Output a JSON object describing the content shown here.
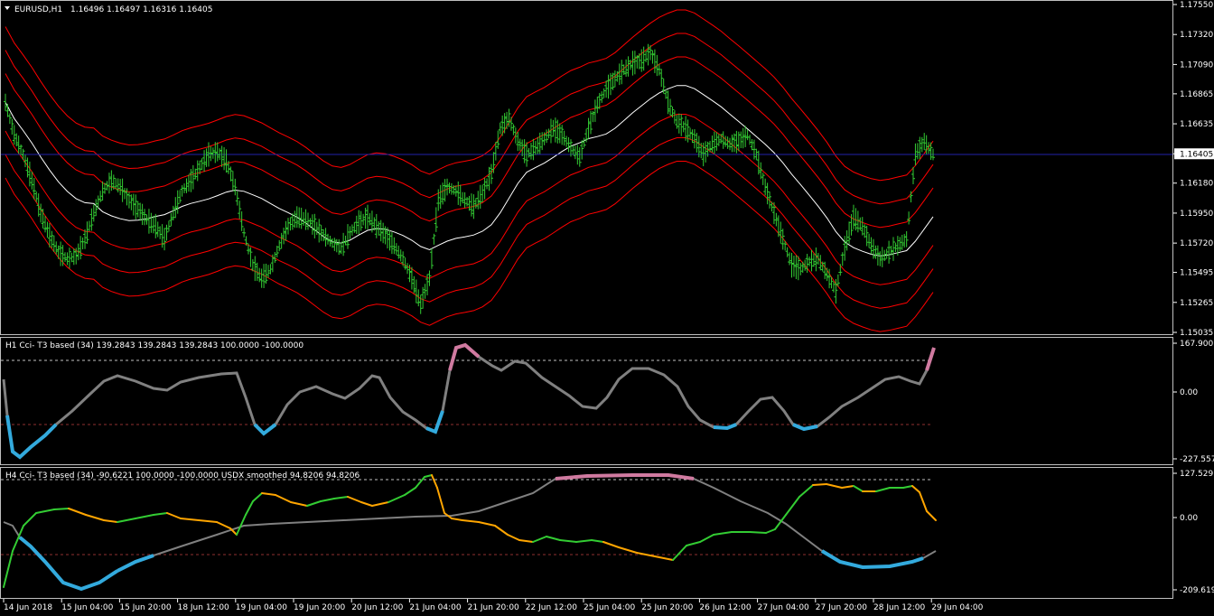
{
  "window": {
    "symbol_header": "EURUSD,H1",
    "ohlc": "1.16496 1.16497 1.16316 1.16405"
  },
  "panels": {
    "main": {
      "price_ticks": [
        "1.17550",
        "1.17320",
        "1.17090",
        "1.16865",
        "1.16635",
        "1.16405",
        "1.16180",
        "1.15950",
        "1.15720",
        "1.15495",
        "1.15265",
        "1.15035"
      ],
      "current_price": "1.16405"
    },
    "cci_h1": {
      "title": "H1 Cci- T3 based (34) 139.2843 139.2843 139.2843 100.0000 -100.0000",
      "ticks": [
        "167.9007",
        "0.00",
        "-227.5573"
      ]
    },
    "cci_h4": {
      "title": "H4 Cci- T3 based (34) -90.6221 100.0000 -100.0000  USDX smoothed  94.8206 94.8206",
      "ticks": [
        "127.5291",
        "0.00",
        "-209.6193"
      ]
    }
  },
  "time_axis": [
    "14 Jun 2018",
    "15 Jun 04:00",
    "15 Jun 20:00",
    "18 Jun 12:00",
    "19 Jun 04:00",
    "19 Jun 20:00",
    "20 Jun 12:00",
    "21 Jun 04:00",
    "21 Jun 20:00",
    "22 Jun 12:00",
    "25 Jun 04:00",
    "25 Jun 20:00",
    "26 Jun 12:00",
    "27 Jun 04:00",
    "27 Jun 20:00",
    "28 Jun 12:00",
    "29 Jun 04:00"
  ],
  "colors": {
    "background": "#000000",
    "candles": "#33cc33",
    "bands": "#ff0000",
    "midline": "#ffffff",
    "price_line": "#2222aa",
    "cci_neutral": "#808080",
    "cci_high": "#d07aa0",
    "cci_low": "#33aadd",
    "h4_up": "#33cc33",
    "h4_down": "#ffa500",
    "levels": "#c04040"
  },
  "chart_data": {
    "type": "line",
    "price_close": [
      1.168,
      1.1655,
      1.164,
      1.162,
      1.1595,
      1.1578,
      1.1565,
      1.156,
      1.1562,
      1.1575,
      1.1595,
      1.1612,
      1.162,
      1.1615,
      1.1605,
      1.1598,
      1.159,
      1.1585,
      1.1575,
      1.1595,
      1.1612,
      1.162,
      1.163,
      1.164,
      1.1642,
      1.1635,
      1.1615,
      1.158,
      1.1555,
      1.1545,
      1.1552,
      1.157,
      1.1585,
      1.1592,
      1.159,
      1.1585,
      1.1578,
      1.1572,
      1.1568,
      1.158,
      1.1588,
      1.1592,
      1.1585,
      1.1578,
      1.157,
      1.156,
      1.1545,
      1.1525,
      1.1545,
      1.1605,
      1.1615,
      1.1612,
      1.1605,
      1.16,
      1.161,
      1.1625,
      1.166,
      1.1668,
      1.165,
      1.164,
      1.1645,
      1.1652,
      1.166,
      1.1655,
      1.1645,
      1.1638,
      1.166,
      1.1678,
      1.169,
      1.1698,
      1.1705,
      1.171,
      1.1712,
      1.1718,
      1.1705,
      1.168,
      1.1665,
      1.166,
      1.1652,
      1.164,
      1.1648,
      1.1652,
      1.1648,
      1.165,
      1.1655,
      1.164,
      1.1615,
      1.1595,
      1.1575,
      1.1555,
      1.1552,
      1.1558,
      1.156,
      1.1548,
      1.1535,
      1.1568,
      1.1592,
      1.1585,
      1.157,
      1.156,
      1.1565,
      1.157,
      1.1575,
      1.164,
      1.165,
      1.164
    ]
  }
}
